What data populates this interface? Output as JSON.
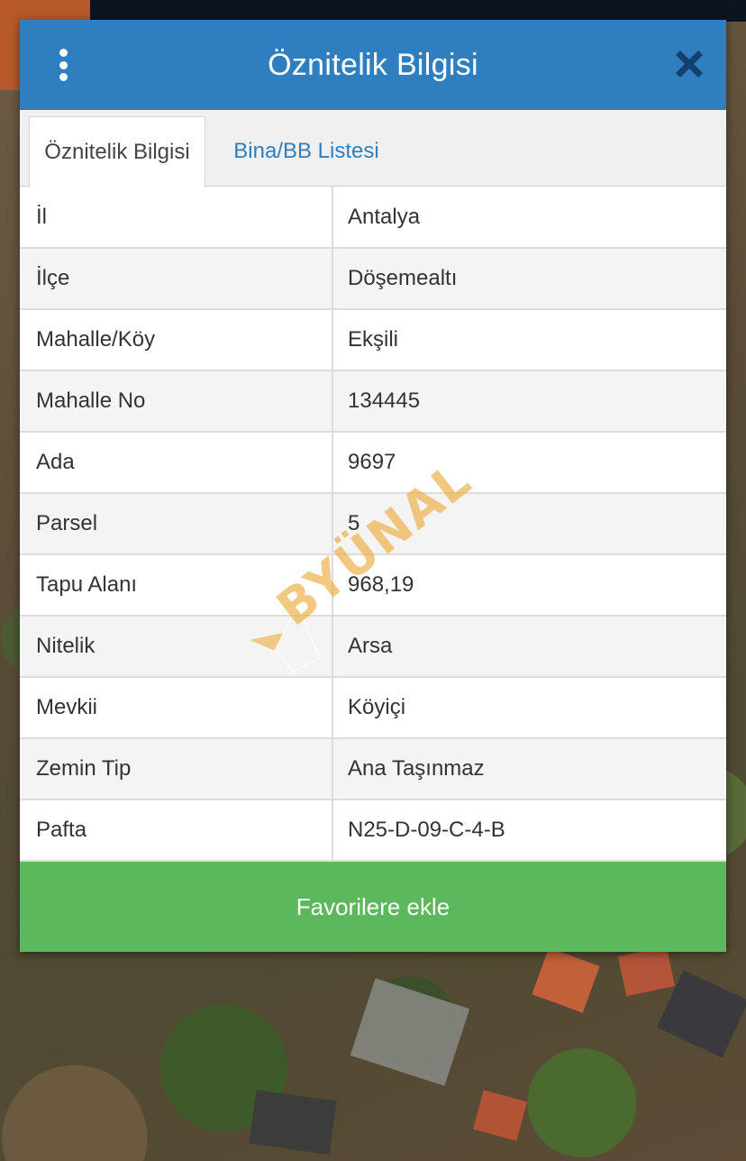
{
  "dialog": {
    "title": "Öznitelik Bilgisi"
  },
  "tabs": [
    {
      "label": "Öznitelik Bilgisi",
      "active": true
    },
    {
      "label": "Bina/BB Listesi",
      "active": false
    }
  ],
  "attributes": [
    {
      "key": "İl",
      "value": "Antalya"
    },
    {
      "key": "İlçe",
      "value": "Döşemealtı"
    },
    {
      "key": "Mahalle/Köy",
      "value": "Ekşili"
    },
    {
      "key": "Mahalle No",
      "value": "134445"
    },
    {
      "key": "Ada",
      "value": "9697"
    },
    {
      "key": "Parsel",
      "value": "5"
    },
    {
      "key": "Tapu Alanı",
      "value": "968,19"
    },
    {
      "key": "Nitelik",
      "value": "Arsa"
    },
    {
      "key": "Mevkii",
      "value": "Köyiçi"
    },
    {
      "key": "Zemin Tip",
      "value": "Ana Taşınmaz"
    },
    {
      "key": "Pafta",
      "value": "N25-D-09-C-4-B"
    }
  ],
  "favorite_button": {
    "label": "Favorilere ekle"
  },
  "watermark": {
    "text": "BYÜNAL"
  },
  "icons": {
    "menu": "kebab-menu-icon",
    "close": "close-icon"
  },
  "colors": {
    "header": "#2f7ebf",
    "tab_link": "#2f7ebf",
    "favorite_button": "#5cb85c"
  }
}
